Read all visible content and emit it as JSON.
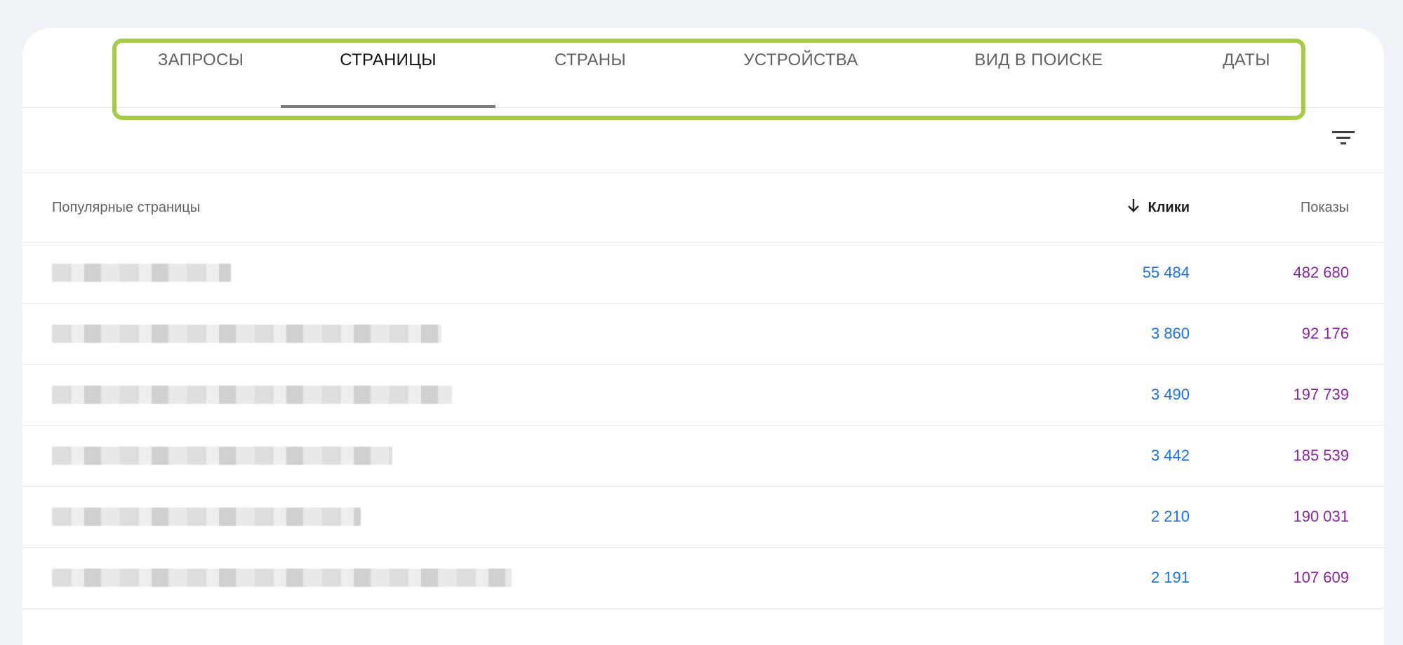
{
  "tabs": [
    {
      "label": "ЗАПРОСЫ",
      "active": false
    },
    {
      "label": "СТРАНИЦЫ",
      "active": true
    },
    {
      "label": "СТРАНЫ",
      "active": false
    },
    {
      "label": "УСТРОЙСТВА",
      "active": false
    },
    {
      "label": "ВИД В ПОИСКЕ",
      "active": false
    },
    {
      "label": "ДАТЫ",
      "active": false
    }
  ],
  "table": {
    "headers": {
      "page": "Популярные страницы",
      "clicks": "Клики",
      "impressions": "Показы"
    },
    "rows": [
      {
        "clicks": "55 484",
        "impressions": "482 680"
      },
      {
        "clicks": "3 860",
        "impressions": "92 176"
      },
      {
        "clicks": "3 490",
        "impressions": "197 739"
      },
      {
        "clicks": "3 442",
        "impressions": "185 539"
      },
      {
        "clicks": "2 210",
        "impressions": "190 031"
      },
      {
        "clicks": "2 191",
        "impressions": "107 609"
      }
    ]
  },
  "colors": {
    "highlight": "#a6cc45",
    "clicks": "#1a73e8",
    "impressions": "#8e24aa"
  },
  "icons": {
    "filter": "filter-icon",
    "sort": "arrow-down-icon"
  }
}
